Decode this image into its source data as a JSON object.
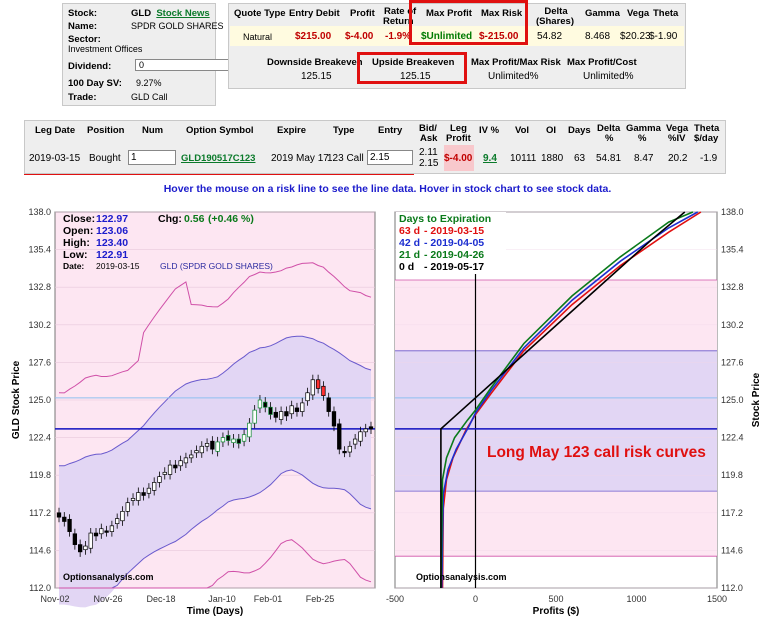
{
  "stock": {
    "stock_label": "Stock:",
    "symbol": "GLD",
    "news_link": "Stock News",
    "name_label": "Name:",
    "name": "SPDR GOLD SHARES",
    "sector_label": "Sector:",
    "sector": "Investment Offices",
    "dividend_label": "Dividend:",
    "dividend_value": "0",
    "dividend_unit": "%",
    "sv_label": "100 Day SV:",
    "sv_value": "9.27%",
    "trade_label": "Trade:",
    "trade_value": "GLD Call"
  },
  "quote": {
    "headers": {
      "quote_type": "Quote Type",
      "entry_debit": "Entry Debit",
      "profit": "Profit",
      "rate": "Rate of",
      "rate2": "Return",
      "max_profit": "Max Profit",
      "max_risk": "Max Risk",
      "delta": "Delta",
      "delta2": "(Shares)",
      "gamma": "Gamma",
      "vega": "Vega",
      "theta": "Theta"
    },
    "row": {
      "quote_type": "Natural",
      "entry_debit": "$215.00",
      "profit": "$-4.00",
      "rate": "-1.9%",
      "max_profit": "$Unlimited",
      "max_risk": "$-215.00",
      "delta": "54.82",
      "gamma": "8.468",
      "vega": "$20.23",
      "theta": "$-1.90"
    },
    "breakevens": {
      "down_label": "Downside Breakeven",
      "down_value": "125.15",
      "up_label": "Upside Breakeven",
      "up_value": "125.15",
      "pm_label": "Max Profit/Max Risk",
      "pm_value": "Unlimited%",
      "pc_label": "Max Profit/Cost",
      "pc_value": "Unlimited%"
    }
  },
  "legs": {
    "headers": {
      "leg_date": "Leg Date",
      "position": "Position",
      "num": "Num",
      "symbol": "Option Symbol",
      "expire": "Expire",
      "type": "Type",
      "entry": "Entry",
      "bidask": "Bid/",
      "bidask2": "Ask",
      "legprofit": "Leg",
      "legprofit2": "Profit",
      "iv": "IV %",
      "vol": "Vol",
      "oi": "OI",
      "days": "Days",
      "delta": "Delta",
      "delta2": "%",
      "gamma": "Gamma",
      "gamma2": "%",
      "vega": "Vega",
      "vega2": "%IV",
      "theta": "Theta",
      "theta2": "$/day"
    },
    "row": {
      "leg_date": "2019-03-15",
      "position": "Bought",
      "num": "1",
      "symbol": "GLD190517C123",
      "expire": "2019 May 17",
      "type": "123 Call",
      "entry": "2.15",
      "bid": "2.11",
      "ask": "2.15",
      "legprofit": "$-4.00",
      "iv": "9.4",
      "vol": "10111",
      "oi": "1880",
      "days": "63",
      "delta": "54.81",
      "gamma": "8.47",
      "vega": "20.2",
      "theta": "-1.9"
    }
  },
  "hover_text": "Hover the mouse on a risk line to see the line data. Hover in stock chart to see stock data.",
  "stock_chart": {
    "close_label": "Close:",
    "close": "122.97",
    "open_label": "Open:",
    "open": "123.06",
    "high_label": "High:",
    "high": "123.40",
    "low_label": "Low:",
    "low": "122.91",
    "date_label": "Date:",
    "date": "2019-03-15",
    "chg_label": "Chg:",
    "chg": "0.56",
    "chg_pct": "(+0.46 %)",
    "name_caption": "GLD (SPDR GOLD SHARES)",
    "watermark": "Optionsanalysis.com",
    "ylabel": "GLD Stock Price",
    "xlabel": "Time (Days)",
    "xticks": [
      "Nov-02",
      "Nov-26",
      "Dec-18",
      "Jan-10",
      "Feb-01",
      "Feb-25"
    ]
  },
  "risk_chart": {
    "title": "Days to Expiration",
    "legend": [
      {
        "days": "63 d",
        "date": "- 2019-03-15",
        "color": "#e01010"
      },
      {
        "days": "42 d",
        "date": "- 2019-04-05",
        "color": "#1c2ed0"
      },
      {
        "days": "21 d",
        "date": "- 2019-04-26",
        "color": "#0a7a1a"
      },
      {
        "days": "0 d",
        "date": "- 2019-05-17",
        "color": "#000000"
      }
    ],
    "annotation": "Long May 123 call risk curves",
    "watermark": "Optionsanalysis.com",
    "ylabel": "Stock Price",
    "xlabel": "Profits ($)",
    "xticks": [
      "-500",
      "0",
      "500",
      "1000",
      "1500"
    ]
  },
  "chart_data": [
    {
      "type": "candlestick",
      "ylim": [
        112.0,
        138.0
      ],
      "yticks": [
        "138.0",
        "135.4",
        "132.8",
        "130.2",
        "127.6",
        "125.0",
        "122.4",
        "119.8",
        "117.2",
        "114.6",
        "112.0"
      ],
      "current_price": 123.0,
      "closes": [
        116.9,
        116.6,
        115.9,
        115.0,
        114.5,
        114.9,
        115.8,
        115.6,
        116.1,
        115.9,
        116.3,
        116.8,
        117.3,
        117.9,
        118.2,
        118.6,
        118.4,
        118.9,
        119.3,
        119.7,
        120.0,
        120.5,
        120.3,
        120.8,
        121.0,
        121.2,
        121.5,
        121.8,
        122.0,
        121.6,
        122.1,
        122.4,
        122.2,
        122.3,
        122.0,
        122.6,
        123.4,
        124.3,
        125.0,
        124.5,
        124.0,
        123.8,
        124.2,
        123.9,
        124.6,
        124.2,
        124.8,
        125.5,
        126.4,
        125.8,
        125.3,
        124.2,
        123.2,
        121.6,
        121.4,
        121.8,
        122.3,
        122.8,
        123.0,
        123.0
      ]
    },
    {
      "type": "line",
      "ylim": [
        112.0,
        138.0
      ],
      "xlim": [
        -500,
        1500
      ],
      "yticks": [
        "138.0",
        "135.4",
        "132.8",
        "130.2",
        "127.6",
        "125.0",
        "122.4",
        "119.8",
        "117.2",
        "114.6",
        "112.0"
      ],
      "series": [
        {
          "name": "63 d",
          "points": [
            [
              -205,
              112.0
            ],
            [
              -200,
              117.5
            ],
            [
              -180,
              119.5
            ],
            [
              -140,
              121.0
            ],
            [
              -60,
              122.9
            ],
            [
              0,
              124.0
            ],
            [
              100,
              125.5
            ],
            [
              300,
              128.4
            ],
            [
              600,
              131.6
            ],
            [
              900,
              134.3
            ],
            [
              1200,
              136.6
            ],
            [
              1400,
              138.0
            ]
          ]
        },
        {
          "name": "42 d",
          "points": [
            [
              -210,
              112.0
            ],
            [
              -200,
              118.5
            ],
            [
              -170,
              120.2
            ],
            [
              -120,
              121.6
            ],
            [
              -40,
              123.2
            ],
            [
              0,
              124.1
            ],
            [
              100,
              125.7
            ],
            [
              300,
              128.6
            ],
            [
              600,
              131.9
            ],
            [
              900,
              134.6
            ],
            [
              1200,
              136.9
            ],
            [
              1380,
              138.0
            ]
          ]
        },
        {
          "name": "21 d",
          "points": [
            [
              -214,
              112.0
            ],
            [
              -205,
              119.5
            ],
            [
              -180,
              121.0
            ],
            [
              -130,
              122.4
            ],
            [
              -50,
              123.6
            ],
            [
              0,
              124.3
            ],
            [
              100,
              125.9
            ],
            [
              300,
              128.9
            ],
            [
              600,
              132.2
            ],
            [
              900,
              134.9
            ],
            [
              1200,
              137.3
            ],
            [
              1350,
              138.0
            ]
          ]
        },
        {
          "name": "0 d",
          "points": [
            [
              -215,
              112.0
            ],
            [
              -215,
              123.0
            ],
            [
              -165,
              123.5
            ],
            [
              0,
              125.15
            ],
            [
              200,
              127.15
            ],
            [
              500,
              130.15
            ],
            [
              800,
              133.15
            ],
            [
              1100,
              136.15
            ],
            [
              1300,
              138.0
            ]
          ]
        }
      ]
    }
  ]
}
